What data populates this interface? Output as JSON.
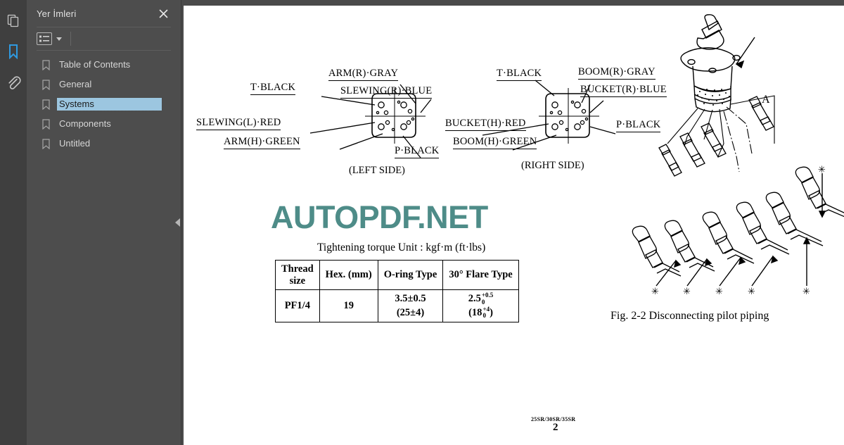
{
  "app": {
    "rail_icons": [
      {
        "name": "page-thumbnails-icon",
        "active": false
      },
      {
        "name": "bookmarks-icon",
        "active": true
      },
      {
        "name": "attachments-icon",
        "active": false
      }
    ]
  },
  "panel": {
    "title": "Yer İmleri",
    "close_label": "✕",
    "toolbar": {
      "list_options_label": "list-view",
      "dropdown_label": "▾"
    },
    "bookmarks": [
      {
        "label": "Table of Contents",
        "selected": false
      },
      {
        "label": "General",
        "selected": false
      },
      {
        "label": "Systems",
        "selected": true
      },
      {
        "label": "Components",
        "selected": false
      },
      {
        "label": "Untitled",
        "selected": false
      }
    ],
    "collapse_label": "◀",
    "selected_bg": "#9cc6e0"
  },
  "document": {
    "watermark": "AUTOPDF.NET",
    "watermark_color": "#4e8c88",
    "left_connector": {
      "caption": "(LEFT SIDE)",
      "labels": [
        "T·BLACK",
        "ARM(R)·GRAY",
        "SLEWING(R)·BLUE",
        "SLEWING(L)·RED",
        "ARM(H)·GREEN",
        "P·BLACK"
      ]
    },
    "right_connector": {
      "caption": "(RIGHT SIDE)",
      "labels": [
        "T·BLACK",
        "BOOM(R)·GRAY",
        "BUCKET(R)·BLUE",
        "BUCKET(H)·RED",
        "BOOM(H)·GREEN",
        "P·BLACK"
      ]
    },
    "torque": {
      "caption": "Tightening torque   Unit : kgf·m (ft·lbs)",
      "headers": [
        "Thread size",
        "Hex. (mm)",
        "O-ring Type",
        "30° Flare Type"
      ],
      "header_line1": [
        "Thread",
        "Hex. (mm)",
        "O-ring Type",
        "30° Flare Type"
      ],
      "header_line2": [
        "size",
        "",
        "",
        ""
      ],
      "rows": [
        {
          "thread_size": "PF1/4",
          "hex_mm": "19",
          "oring_main": "3.5±0.5",
          "oring_alt": "(25±4)",
          "flare_main": "2.5",
          "flare_sup_top": "+0.5",
          "flare_sup_bot": "0",
          "flare_alt_open": "(18",
          "flare_alt_sup_top": "+4",
          "flare_alt_sup_bot": "0",
          "flare_alt_close": ")"
        }
      ]
    },
    "figure": {
      "caption": "Fig. 2-2 Disconnecting pilot piping",
      "callout_a": "A",
      "star_mark": "✳",
      "star_count": 6
    },
    "footer": {
      "model": "25SR/30SR/35SR",
      "page_number": "2"
    }
  }
}
